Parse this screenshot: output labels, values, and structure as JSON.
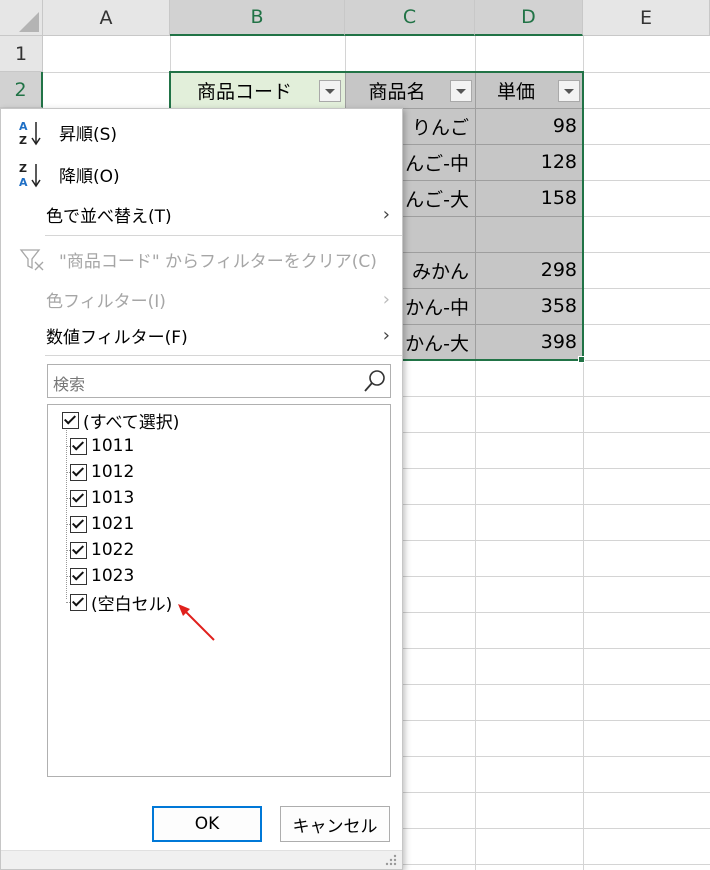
{
  "columns": [
    "A",
    "B",
    "C",
    "D",
    "E"
  ],
  "rows": [
    "1",
    "2"
  ],
  "table": {
    "headers": [
      "商品コード",
      "商品名",
      "単価"
    ],
    "visible_names": [
      "りんご",
      "んご-中",
      "んご-大",
      "",
      "みかん",
      "かん-中",
      "かん-大"
    ],
    "prices": [
      "98",
      "128",
      "158",
      "",
      "298",
      "358",
      "398"
    ]
  },
  "menu": {
    "sort_asc": "昇順(S)",
    "sort_desc": "降順(O)",
    "sort_by_color": "色で並べ替え(T)",
    "clear_filter": "\"商品コード\" からフィルターをクリア(C)",
    "color_filter": "色フィルター(I)",
    "number_filter": "数値フィルター(F)",
    "search_placeholder": "検索",
    "items": [
      "(すべて選択)",
      "1011",
      "1012",
      "1013",
      "1021",
      "1022",
      "1023",
      "(空白セル)"
    ],
    "ok": "OK",
    "cancel": "キャンセル"
  },
  "colors": {
    "accent": "#217346",
    "selection": "#c6c6c6",
    "header_cell": "#e2efda",
    "arrow": "#e0201c"
  }
}
